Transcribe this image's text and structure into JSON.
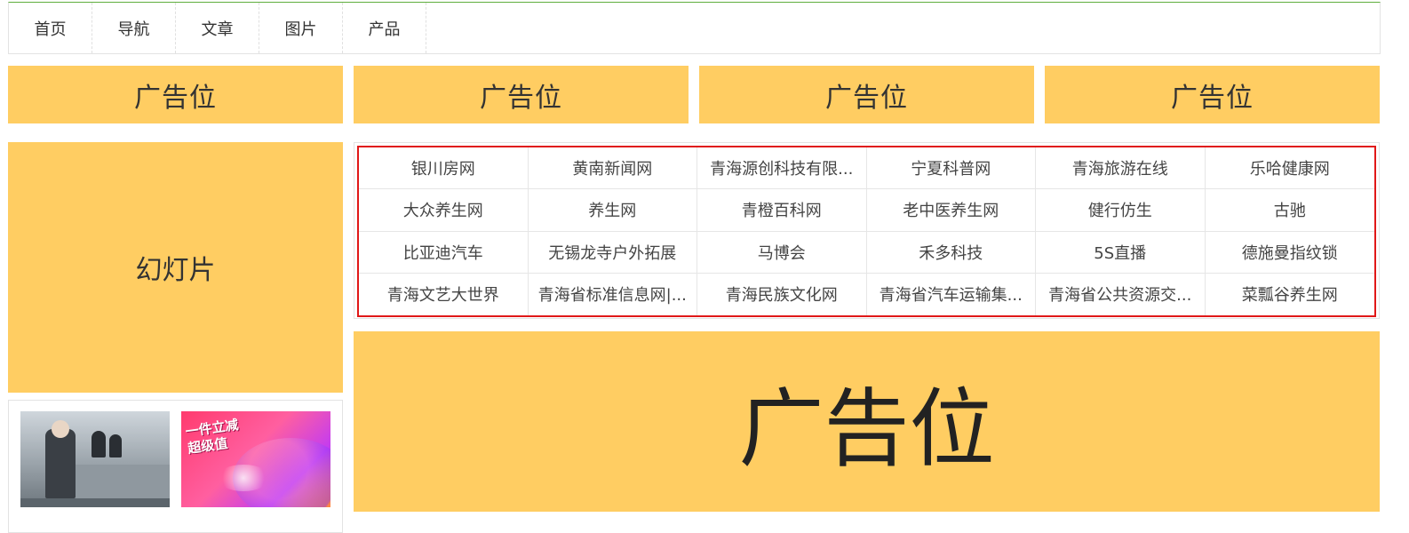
{
  "nav": {
    "items": [
      "首页",
      "导航",
      "文章",
      "图片",
      "产品"
    ]
  },
  "ads": {
    "top_label": "广告位",
    "big_label": "广告位"
  },
  "slideshow": {
    "label": "幻灯片"
  },
  "links": {
    "rows": [
      [
        "银川房网",
        "黄南新闻网",
        "青海源创科技有限...",
        "宁夏科普网",
        "青海旅游在线",
        "乐哈健康网"
      ],
      [
        "大众养生网",
        "养生网",
        "青橙百科网",
        "老中医养生网",
        "健行仿生",
        "古驰"
      ],
      [
        "比亚迪汽车",
        "无锡龙寺户外拓展",
        "马博会",
        "禾多科技",
        "5S直播",
        "德施曼指纹锁"
      ],
      [
        "青海文艺大世界",
        "青海省标准信息网|...",
        "青海民族文化网",
        "青海省汽车运输集...",
        "青海省公共资源交...",
        "菜瓢谷养生网"
      ]
    ]
  },
  "news": {
    "promo_line1": "一件立减",
    "promo_line2": "超级值"
  },
  "colors": {
    "ad_background": "#ffcd62",
    "links_border": "#e01818",
    "nav_top_border": "#5fae3d"
  }
}
